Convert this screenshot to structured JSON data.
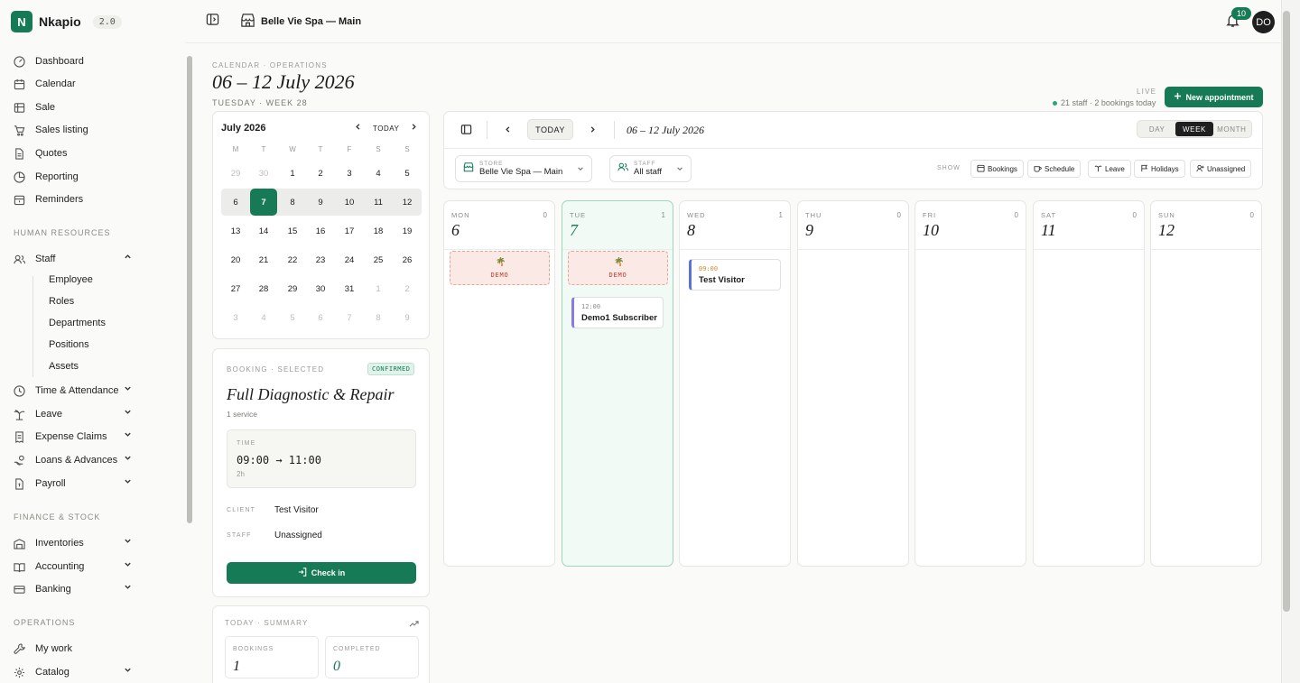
{
  "app": {
    "name": "Nkapio",
    "version": "2.0",
    "logo_letter": "N"
  },
  "colors": {
    "accent": "#157a55",
    "demo": "#c0392b",
    "event_border": "#8a7be0"
  },
  "topbar": {
    "store": "Belle Vie Spa — Main",
    "notifications": "10",
    "avatar": "DO"
  },
  "sidebar": {
    "items": [
      {
        "label": "Dashboard",
        "icon": "gauge-icon"
      },
      {
        "label": "Calendar",
        "icon": "calendar-icon"
      },
      {
        "label": "Sale",
        "icon": "register-icon"
      },
      {
        "label": "Sales listing",
        "icon": "cart-icon"
      },
      {
        "label": "Quotes",
        "icon": "document-icon"
      },
      {
        "label": "Reporting",
        "icon": "pie-chart-icon"
      },
      {
        "label": "Reminders",
        "icon": "calendar-reminder-icon"
      }
    ],
    "sections": [
      "HUMAN RESOURCES",
      "FINANCE & STOCK",
      "OPERATIONS"
    ],
    "staff": {
      "label": "Staff",
      "sub": [
        "Employee",
        "Roles",
        "Departments",
        "Positions",
        "Assets"
      ]
    },
    "hr_items": [
      "Time & Attendance",
      "Leave",
      "Expense Claims",
      "Loans & Advances",
      "Payroll"
    ],
    "finance_items": [
      "Inventories",
      "Accounting",
      "Banking"
    ],
    "ops_items": [
      "My work",
      "Catalog"
    ]
  },
  "header": {
    "crumb": "CALENDAR · OPERATIONS",
    "title": "06 – 12 July 2026",
    "subtitle": "TUESDAY · WEEK 28",
    "live": "LIVE",
    "live_meta": "21 staff · 2 bookings today",
    "new_appointment": "New appointment"
  },
  "mini_calendar": {
    "month": "July 2026",
    "today": "TODAY",
    "dow": [
      "M",
      "T",
      "W",
      "T",
      "F",
      "S",
      "S"
    ],
    "weeks": [
      [
        "29",
        "30",
        "1",
        "2",
        "3",
        "4",
        "5"
      ],
      [
        "6",
        "7",
        "8",
        "9",
        "10",
        "11",
        "12"
      ],
      [
        "13",
        "14",
        "15",
        "16",
        "17",
        "18",
        "19"
      ],
      [
        "20",
        "21",
        "22",
        "23",
        "24",
        "25",
        "26"
      ],
      [
        "27",
        "28",
        "29",
        "30",
        "31",
        "1",
        "2"
      ],
      [
        "3",
        "4",
        "5",
        "6",
        "7",
        "8",
        "9"
      ]
    ]
  },
  "booking": {
    "label": "BOOKING · SELECTED",
    "status": "CONFIRMED",
    "title": "Full Diagnostic & Repair",
    "sub": "1 service",
    "time_label": "TIME",
    "time": "09:00 → 11:00",
    "duration": "2h",
    "client_label": "CLIENT",
    "client": "Test Visitor",
    "staff_label": "STAFF",
    "staff": "Unassigned",
    "checkin": "Check in"
  },
  "summary": {
    "label": "TODAY · SUMMARY",
    "bookings_label": "BOOKINGS",
    "bookings": "1",
    "completed_label": "COMPLETED",
    "completed": "0"
  },
  "toolbar": {
    "today": "TODAY",
    "range": "06 – 12 July 2026",
    "views": [
      "DAY",
      "WEEK",
      "MONTH"
    ],
    "store_label": "STORE",
    "store": "Belle Vie Spa — Main",
    "staff_label": "STAFF",
    "staff": "All staff",
    "show": "SHOW",
    "chips": [
      "Bookings",
      "Schedule",
      "Leave",
      "Holidays",
      "Unassigned"
    ]
  },
  "week": [
    {
      "dow": "MON",
      "num": "6",
      "count": "0"
    },
    {
      "dow": "TUE",
      "num": "7",
      "count": "1"
    },
    {
      "dow": "WED",
      "num": "8",
      "count": "1"
    },
    {
      "dow": "THU",
      "num": "9",
      "count": "0"
    },
    {
      "dow": "FRI",
      "num": "10",
      "count": "0"
    },
    {
      "dow": "SAT",
      "num": "11",
      "count": "0"
    },
    {
      "dow": "SUN",
      "num": "12",
      "count": "0"
    }
  ],
  "events": {
    "demo_label": "DEMO",
    "tue": {
      "time": "12:00",
      "name": "Demo1 Subscriber"
    },
    "wed": {
      "time": "09:00",
      "name": "Test Visitor"
    }
  }
}
